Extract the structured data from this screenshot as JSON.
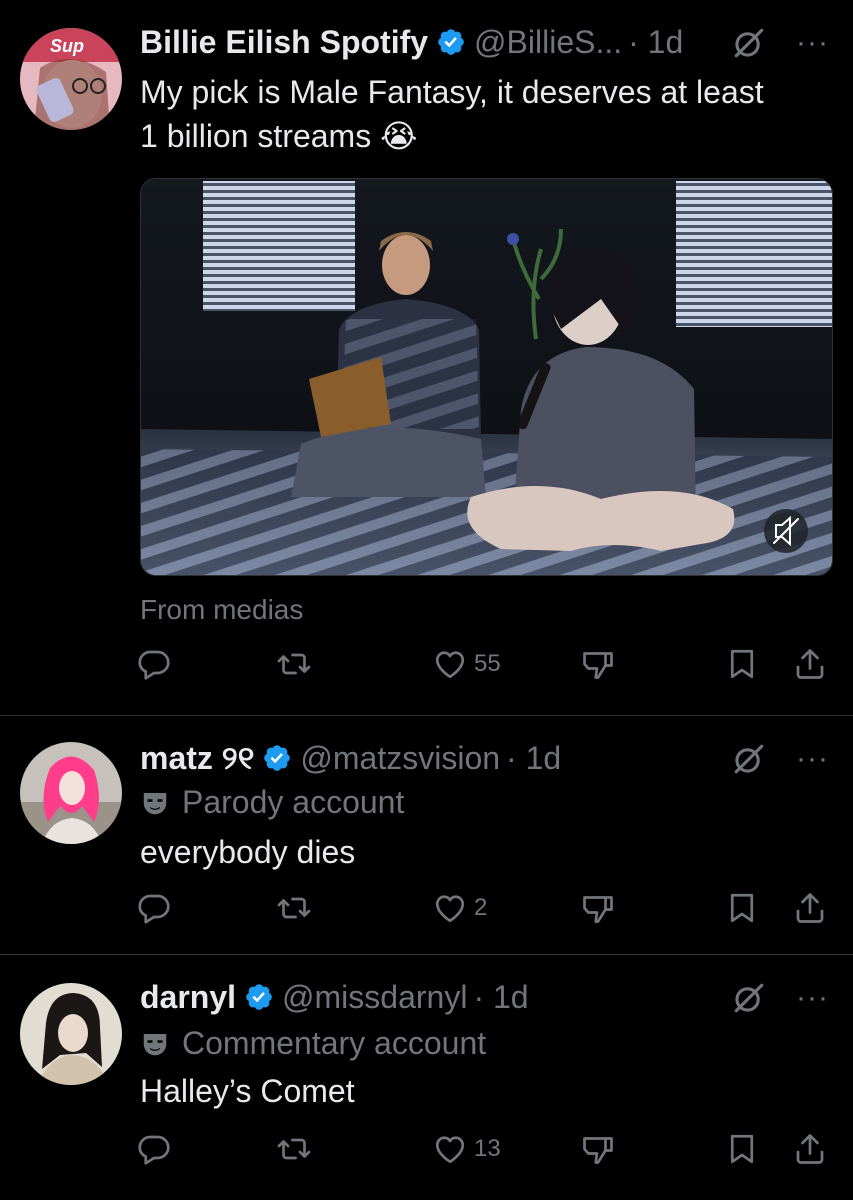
{
  "colors": {
    "background": "#000000",
    "text": "#e7e9ea",
    "muted": "#71767b",
    "verified": "#1d9bf0",
    "separator": "#2f3336"
  },
  "posts": [
    {
      "author": "Billie Eilish Spotify",
      "handle": "@BillieS...",
      "time": "· 1d",
      "text_line1": "My pick is Male Fantasy, it deserves at least",
      "text_line2": "1 billion streams 😭",
      "media_caption": "From medias",
      "replies": "",
      "reposts": "",
      "likes": "55",
      "icon_names": [
        "grok-icon",
        "more-icon",
        "reply-icon",
        "repost-icon",
        "like-icon",
        "dislike-icon",
        "bookmark-icon",
        "share-icon",
        "mute-icon"
      ]
    },
    {
      "author": "matz ୨୧",
      "handle": "@matzsvision",
      "time": "· 1d",
      "account_label": "Parody account",
      "text": "everybody dies",
      "likes": "2"
    },
    {
      "author": "darnyl",
      "handle": "@missdarnyl",
      "time": "· 1d",
      "account_label": "Commentary account",
      "text": "Halley’s Comet",
      "likes": "13"
    }
  ],
  "more_label": "···"
}
